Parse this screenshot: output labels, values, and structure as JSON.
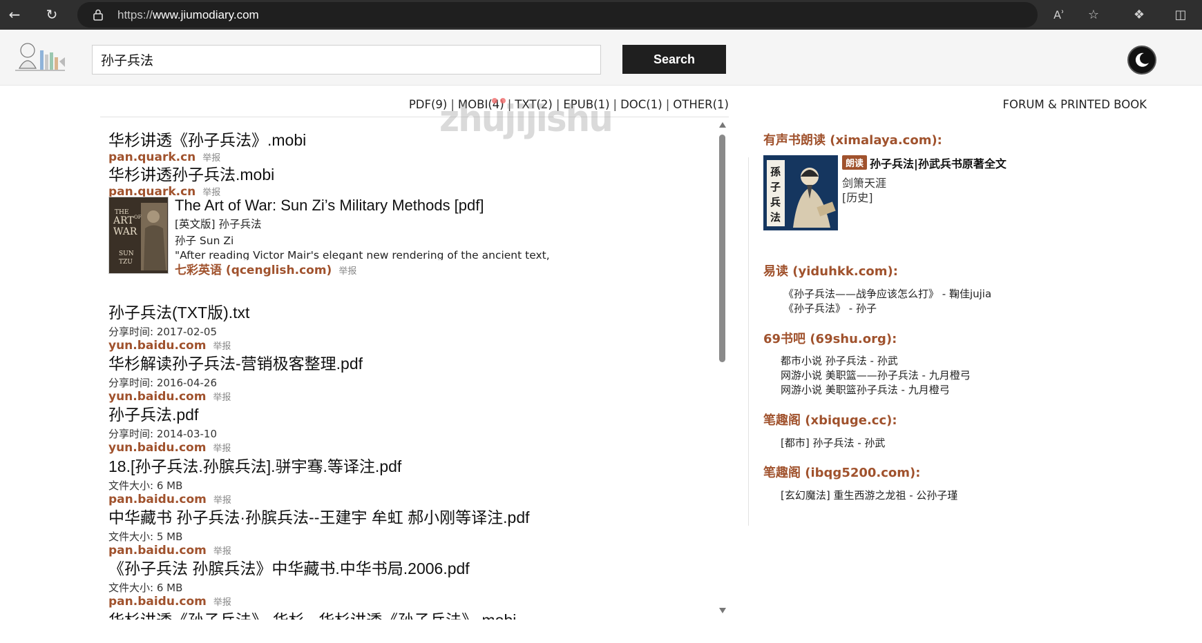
{
  "browser": {
    "url_prefix": "https://",
    "url_host": "www.jiumodiary.com"
  },
  "header": {
    "search_value": "孙子兵法",
    "search_button": "Search"
  },
  "filters": {
    "items": [
      "PDF(9)",
      "MOBI(4)",
      "TXT(2)",
      "EPUB(1)",
      "DOC(1)",
      "OTHER(1)"
    ],
    "separator": "|"
  },
  "watermark": "zhujijishu",
  "results": [
    {
      "title": "华杉讲透《孙子兵法》.mobi",
      "meta": "",
      "source": "pan.quark.cn",
      "report": "举报"
    },
    {
      "title": "华杉讲透孙子兵法.mobi",
      "meta": "",
      "source": "pan.quark.cn",
      "report": "举报"
    },
    {
      "title": "孙子兵法(TXT版).txt",
      "meta": "分享时间: 2017-02-05",
      "source": "yun.baidu.com",
      "report": "举报"
    },
    {
      "title": "华杉解读孙子兵法-营销极客整理.pdf",
      "meta": "分享时间: 2016-04-26",
      "source": "yun.baidu.com",
      "report": "举报"
    },
    {
      "title": "孙子兵法.pdf",
      "meta": "分享时间: 2014-03-10",
      "source": "yun.baidu.com",
      "report": "举报"
    },
    {
      "title": "18.[孙子兵法.孙膑兵法].骈宇骞.等译注.pdf",
      "meta": "文件大小: 6 MB",
      "source": "pan.baidu.com",
      "report": "举报"
    },
    {
      "title": "中华藏书 孙子兵法·孙膑兵法--王建宇 牟虹 郝小刚等译注.pdf",
      "meta": "文件大小: 5 MB",
      "source": "pan.baidu.com",
      "report": "举报"
    },
    {
      "title": "《孙子兵法 孙膑兵法》中华藏书.中华书局.2006.pdf",
      "meta": "文件大小: 6 MB",
      "source": "pan.baidu.com",
      "report": "举报"
    },
    {
      "title": "华杉讲透《孙子兵法》-华杉 - 华杉讲透《孙子兵法》.mobi",
      "meta": "",
      "source": "",
      "report": ""
    }
  ],
  "book_card": {
    "title": "The Art of War: Sun Zi’s Military Methods [pdf]",
    "subtitle": "[英文版] 孙子兵法",
    "author": "孙子 Sun Zi",
    "excerpt": "\"After reading Victor Mair's elegant new rendering of the ancient text,",
    "source": "七彩英语 (qcenglish.com)",
    "report": "举报",
    "cover_lines": [
      "THE",
      "ART",
      "OF",
      "WAR",
      "SUN",
      "TZU"
    ]
  },
  "sidebar": {
    "forum_link": "FORUM & PRINTED BOOK",
    "audio_heading": "有声书朗读 (ximalaya.com):",
    "audio_badge": "朗读",
    "audio_title": "孙子兵法|孙武兵书原著全文",
    "audio_author": "剑箫天涯",
    "audio_category": "[历史]",
    "audio_cover_text": [
      "孫",
      "子",
      "兵",
      "法"
    ],
    "sections": [
      {
        "heading": "易读 (yiduhkk.com):",
        "items": [
          "《孙子兵法——战争应该怎么打》 - 鞠佳jujia",
          "《孙子兵法》 - 孙子"
        ]
      },
      {
        "heading": "69书吧 (69shu.org):",
        "items": [
          "都市小说 孙子兵法 - 孙武",
          "网游小说 美职篮——孙子兵法 - 九月橙弓",
          "网游小说 美职篮孙子兵法 - 九月橙弓"
        ]
      },
      {
        "heading": "笔趣阁 (xbiquge.cc):",
        "items": [
          "[都市] 孙子兵法 - 孙武"
        ]
      },
      {
        "heading": "笔趣阁 (ibqg5200.com):",
        "items": [
          "[玄幻魔法] 重生西游之龙祖 - 公孙子瑾"
        ]
      }
    ]
  }
}
